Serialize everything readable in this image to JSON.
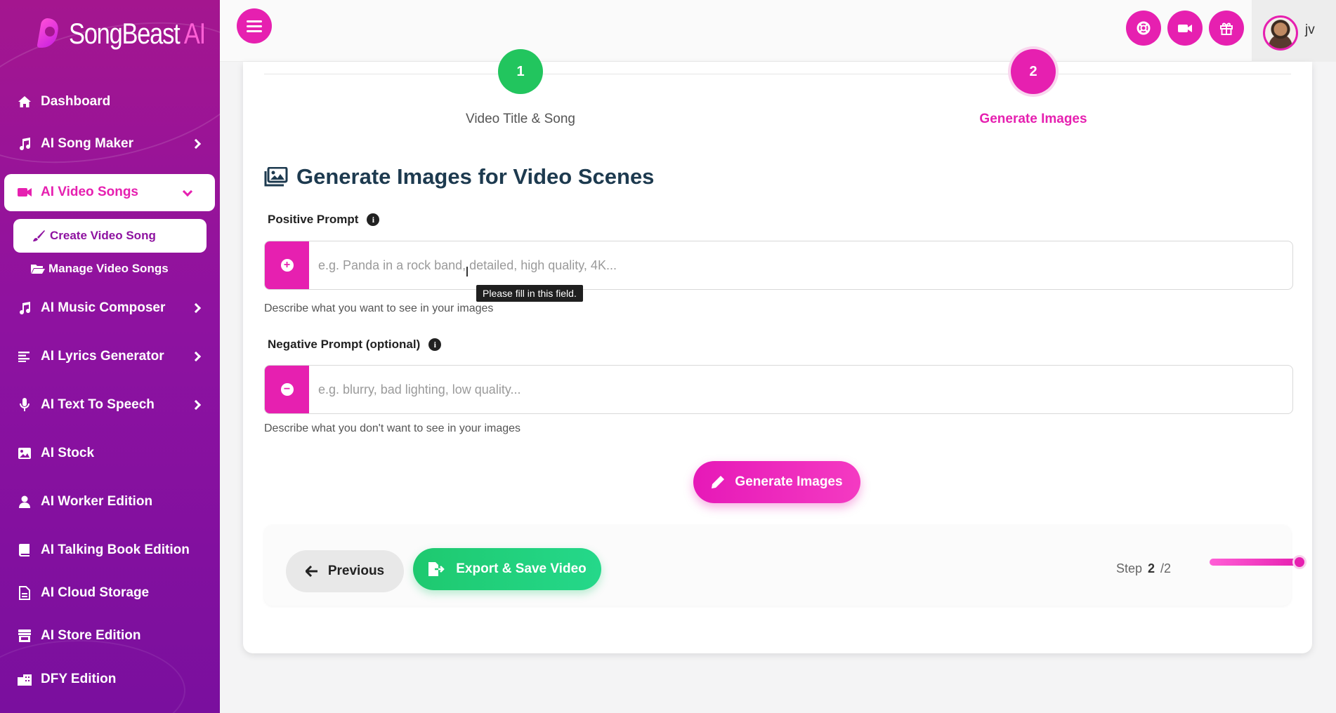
{
  "app": {
    "logo_text": "SongBeast",
    "logo_suffix": "AI"
  },
  "sidebar": {
    "items": [
      {
        "label": "Dashboard",
        "icon": "home-icon"
      },
      {
        "label": "AI Song Maker",
        "icon": "music-icon"
      },
      {
        "label": "AI Video Songs",
        "icon": "video-camera-icon"
      },
      {
        "label": "AI Music Composer",
        "icon": "music-icon"
      },
      {
        "label": "AI Lyrics Generator",
        "icon": "align-left-icon"
      },
      {
        "label": "AI Text To Speech",
        "icon": "microphone-icon"
      },
      {
        "label": "AI Stock",
        "icon": "image-icon"
      },
      {
        "label": "AI Worker Edition",
        "icon": "user-icon"
      },
      {
        "label": "AI Talking Book Edition",
        "icon": "book-icon"
      },
      {
        "label": "AI Cloud Storage",
        "icon": "file-icon"
      },
      {
        "label": "AI Store Edition",
        "icon": "store-icon"
      },
      {
        "label": "DFY Edition",
        "icon": "building-icon"
      }
    ],
    "subitems": [
      {
        "label": "Create Video Song",
        "icon": "paintbrush-icon"
      },
      {
        "label": "Manage Video Songs",
        "icon": "folder-open-icon"
      }
    ]
  },
  "topbar": {
    "icons": [
      "life-ring-icon",
      "video-icon",
      "gift-icon"
    ],
    "username": "jv"
  },
  "stepper": {
    "steps": [
      {
        "number": "1",
        "label": "Video Title & Song"
      },
      {
        "number": "2",
        "label": "Generate Images"
      }
    ]
  },
  "main": {
    "title": "Generate Images for Video Scenes",
    "positive": {
      "label": "Positive Prompt",
      "placeholder": "e.g. Panda in a rock band, detailed, high quality, 4K...",
      "help": "Describe what you want to see in your images",
      "tooltip": "Please fill in this field."
    },
    "negative": {
      "label": "Negative Prompt (optional)",
      "placeholder": "e.g. blurry, bad lighting, low quality...",
      "help": "Describe what you don't want to see in your images"
    },
    "generate_label": "Generate Images"
  },
  "footer": {
    "previous_label": "Previous",
    "export_label": "Export & Save Video",
    "step_word": "Step",
    "step_current": "2",
    "step_total": "/2",
    "progress": 1.0
  },
  "colors": {
    "accent": "#e620b0",
    "success": "#1ec96f",
    "sidebar": "#8e12a0"
  }
}
